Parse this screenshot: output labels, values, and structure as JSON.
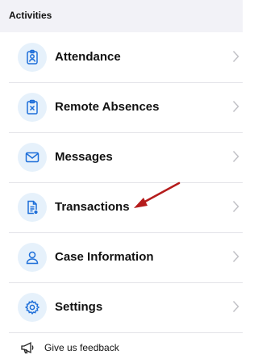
{
  "section": {
    "title": "Activities"
  },
  "items": [
    {
      "label": "Attendance",
      "icon": "id-badge-icon"
    },
    {
      "label": "Remote Absences",
      "icon": "clipboard-x-icon"
    },
    {
      "label": "Messages",
      "icon": "envelope-icon"
    },
    {
      "label": "Transactions",
      "icon": "document-clock-icon"
    },
    {
      "label": "Case Information",
      "icon": "person-icon"
    },
    {
      "label": "Settings",
      "icon": "gear-icon"
    }
  ],
  "feedback": {
    "label": "Give us feedback",
    "icon": "megaphone-icon"
  },
  "colors": {
    "accent": "#1e6fd9",
    "icon_bg": "#e6f1fb",
    "annotation_arrow": "#b51c1c"
  }
}
